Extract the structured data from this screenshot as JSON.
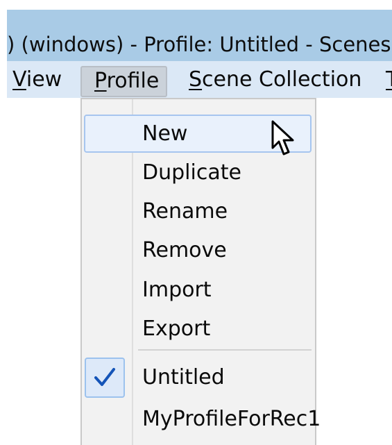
{
  "window": {
    "title": ") (windows) - Profile: Untitled - Scenes:"
  },
  "menubar": {
    "view": {
      "underline": "V",
      "rest": "iew"
    },
    "profile": {
      "underline": "P",
      "rest": "rofile"
    },
    "scene_collection": {
      "underline": "S",
      "rest": "cene Collection"
    },
    "tools": {
      "underline": "T",
      "rest": ""
    }
  },
  "profile_menu": {
    "items": [
      {
        "label": "New",
        "highlighted": true
      },
      {
        "label": "Duplicate"
      },
      {
        "label": "Rename"
      },
      {
        "label": "Remove"
      },
      {
        "label": "Import"
      },
      {
        "label": "Export"
      }
    ],
    "profiles": [
      {
        "label": "Untitled",
        "checked": true
      },
      {
        "label": "MyProfileForRec1",
        "checked": false
      }
    ]
  },
  "icons": {
    "check": "check-icon",
    "cursor": "mouse-pointer-icon"
  },
  "colors": {
    "titlebar": "#a9cbe6",
    "menubar": "#dbe8f6",
    "highlight_border": "#a6c5ef",
    "check": "#1454b8"
  }
}
